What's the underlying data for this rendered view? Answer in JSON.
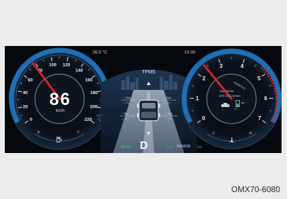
{
  "cluster": {
    "outside_temp": "26.5 °C",
    "clock": "10:30",
    "speed": "86",
    "speed_unit": "km/h",
    "speedo_ticks": [
      "0",
      "20",
      "40",
      "60",
      "80",
      "100",
      "120",
      "140",
      "160",
      "180",
      "200",
      "220"
    ],
    "tacho_ticks": [
      "0",
      "1",
      "2",
      "3",
      "4",
      "5",
      "6",
      "7"
    ],
    "rpm_unit": "x1000r/min",
    "fuel_labels": [
      "E",
      "F"
    ],
    "temp_labels": [
      "C",
      "H"
    ],
    "tpms_title": "TPMS",
    "tire_unit_bar": "bar",
    "tire_unit_c": "°C",
    "tire_readings": [
      "---bar",
      "---°C",
      "---bar",
      "---°C",
      "---bar",
      "---°C",
      "---bar",
      "---°C"
    ],
    "drive_mode": "ECO",
    "gear": "D",
    "odo_label": "ODO",
    "odometer": "666666",
    "odo_unit": "km",
    "trip_line1": "Trip   - 26  km",
    "trip_line2": "AFE   6.6 L/100km",
    "range_value": "20",
    "range_unit": "km"
  },
  "figure": {
    "code": "OMX70-6080"
  },
  "colors": {
    "cluster_bg": "#05080d",
    "gauge_blue": "#1f6fb6",
    "needle_red": "#d6262a",
    "eco_green": "#34c15b",
    "warning_red": "#c3252a"
  },
  "icons": [
    "fuel-pump-icon",
    "coolant-temp-icon",
    "car-top-view-icon",
    "trip-car-icon",
    "fuel-level-icon",
    "city-skyline-icon"
  ]
}
